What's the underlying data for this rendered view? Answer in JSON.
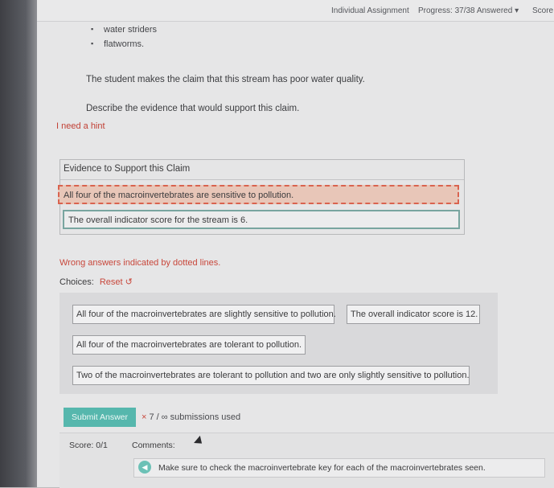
{
  "header": {
    "assignment": "Individual Assignment",
    "progress": "Progress: 37/38 Answered ▾",
    "score": "Score"
  },
  "organisms": [
    "water striders",
    "flatworms."
  ],
  "claim_text": "The student makes the claim that this stream has poor water quality.",
  "prompt_text": "Describe the evidence that would support this claim.",
  "hint_link": "I need a hint",
  "evidence": {
    "header": "Evidence to Support this Claim",
    "answers": [
      "All four of the macroinvertebrates are sensitive to pollution.",
      "The overall indicator score for the stream is 6."
    ]
  },
  "wrong_note": "Wrong answers indicated by dotted lines.",
  "choices_label": "Choices:",
  "reset_label": "Reset",
  "choices": [
    "All four of the macroinvertebrates are slightly sensitive to pollution.",
    "The overall indicator score is 12.",
    "All four of the macroinvertebrates are tolerant to pollution.",
    "Two of the macroinvertebrates are tolerant to pollution and two are only slightly sensitive to pollution."
  ],
  "submit_label": "Submit Answer",
  "submissions": {
    "mark": "×",
    "text": "7 / ∞ submissions used"
  },
  "score_label": "Score: 0/1",
  "comments_label": "Comments:",
  "comment_text": "Make sure to check the macroinvertebrate key for each of the macroinvertebrates seen.",
  "colors": {
    "accent": "#56b7ad",
    "wrong": "#c8473b",
    "wrong_fill": "#e8c6b8"
  }
}
